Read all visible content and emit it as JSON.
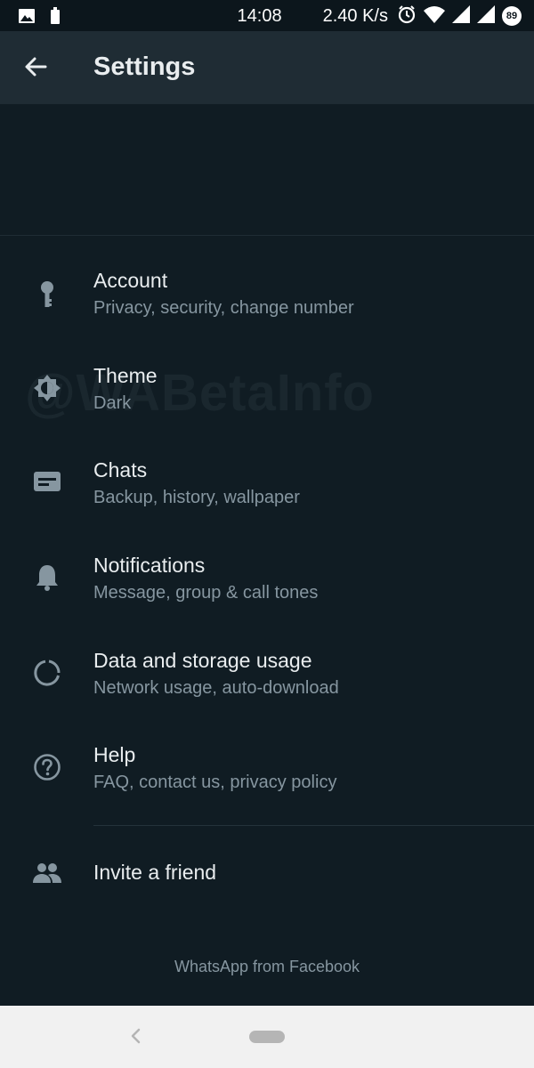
{
  "status_bar": {
    "time": "14:08",
    "network_speed": "2.40 K/s",
    "battery_level": "89",
    "icons": [
      "image-icon",
      "battery-saver-icon",
      "alarm-icon",
      "wifi-icon",
      "signal-icon",
      "signal-icon-2"
    ]
  },
  "app_bar": {
    "title": "Settings",
    "back_icon": "arrow-back-icon"
  },
  "watermark": "@WABetaInfo",
  "settings": [
    {
      "icon": "key-icon",
      "title": "Account",
      "subtitle": "Privacy, security, change number"
    },
    {
      "icon": "brightness-icon",
      "title": "Theme",
      "subtitle": "Dark"
    },
    {
      "icon": "chat-icon",
      "title": "Chats",
      "subtitle": "Backup, history, wallpaper"
    },
    {
      "icon": "bell-icon",
      "title": "Notifications",
      "subtitle": "Message, group & call tones"
    },
    {
      "icon": "data-usage-icon",
      "title": "Data and storage usage",
      "subtitle": "Network usage, auto-download"
    },
    {
      "icon": "help-icon",
      "title": "Help",
      "subtitle": "FAQ, contact us, privacy policy"
    }
  ],
  "invite": {
    "icon": "people-icon",
    "title": "Invite a friend"
  },
  "footer": "WhatsApp from Facebook",
  "nav_bar": {
    "back_icon": "nav-back-icon",
    "home_icon": "nav-home-pill"
  },
  "colors": {
    "background": "#101c23",
    "app_bar": "#1f2c34",
    "primary_text": "#e9edef",
    "secondary_text": "#8696a0",
    "icon": "#8696a0"
  }
}
